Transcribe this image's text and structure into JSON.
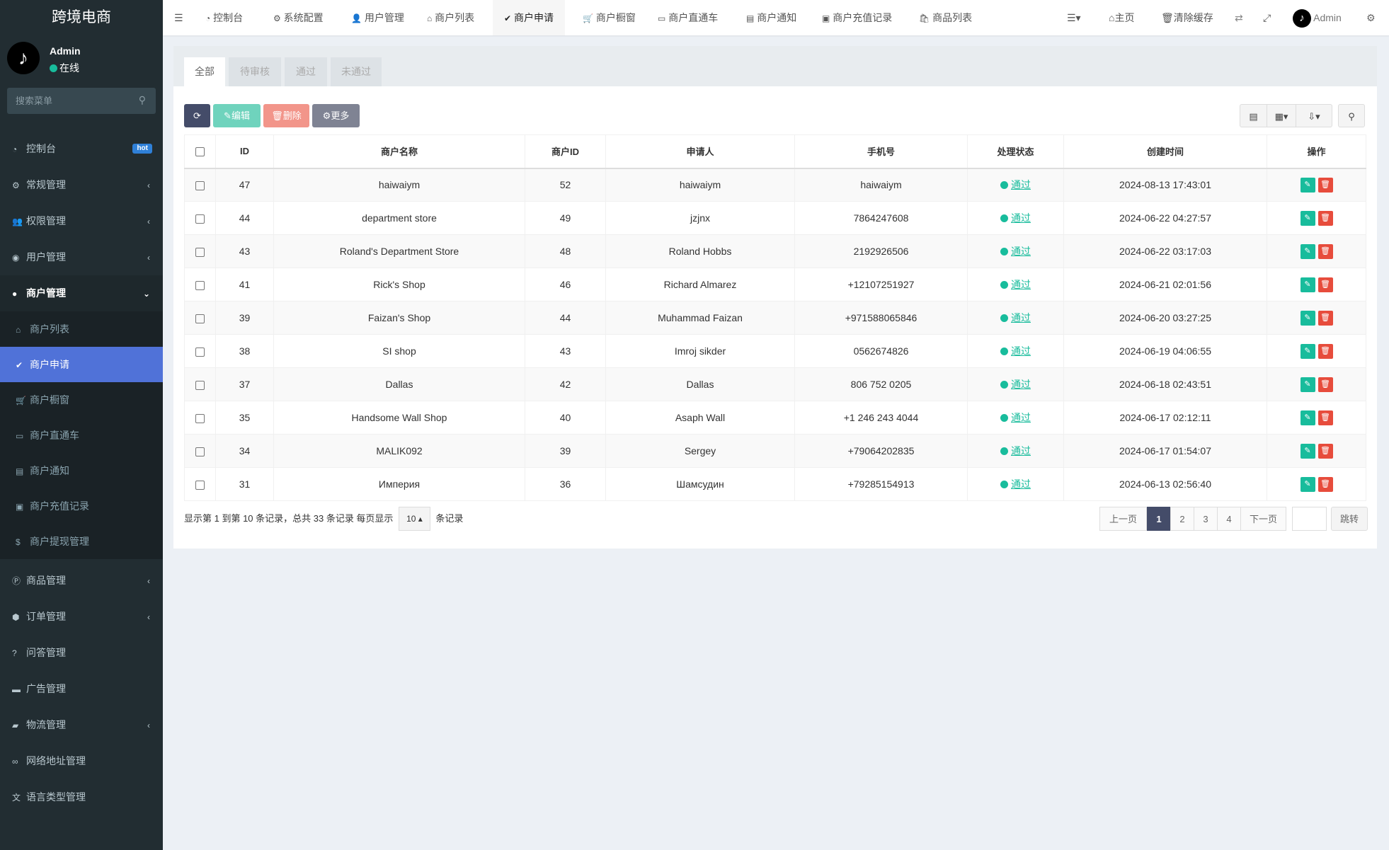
{
  "app": {
    "title": "跨境电商"
  },
  "user": {
    "name": "Admin",
    "status": "在线"
  },
  "search": {
    "placeholder": "搜索菜单"
  },
  "sidebar": {
    "items": [
      {
        "label": "控制台",
        "icon": "dashboard-icon",
        "badge": "hot"
      },
      {
        "label": "常规管理",
        "icon": "cogs-icon"
      },
      {
        "label": "权限管理",
        "icon": "group-icon"
      },
      {
        "label": "用户管理",
        "icon": "user-circle-icon"
      },
      {
        "label": "商户管理",
        "icon": "apple-icon"
      }
    ],
    "sub": [
      {
        "label": "商户列表",
        "icon": "home-icon"
      },
      {
        "label": "商户申请",
        "icon": "check-circle-icon"
      },
      {
        "label": "商户橱窗",
        "icon": "cart-icon"
      },
      {
        "label": "商户直通车",
        "icon": "car-icon"
      },
      {
        "label": "商户通知",
        "icon": "list-alt-icon"
      },
      {
        "label": "商户充值记录",
        "icon": "money-icon"
      },
      {
        "label": "商户提现管理",
        "icon": "dollar-icon"
      }
    ],
    "after": [
      {
        "label": "商品管理",
        "icon": "product-hunt-icon"
      },
      {
        "label": "订单管理",
        "icon": "cube-icon"
      },
      {
        "label": "问答管理",
        "icon": "question-icon"
      },
      {
        "label": "广告管理",
        "icon": "ad-icon"
      },
      {
        "label": "物流管理",
        "icon": "truck-icon"
      },
      {
        "label": "网络地址管理",
        "icon": "link-icon"
      },
      {
        "label": "语言类型管理",
        "icon": "language-icon"
      }
    ]
  },
  "topnav": {
    "tabs": [
      "控制台",
      "系统配置",
      "用户管理",
      "商户列表",
      "商户申请",
      "商户橱窗",
      "商户直通车",
      "商户通知",
      "商户充值记录",
      "商品列表"
    ],
    "home": "主页",
    "clear_cache": "清除缓存",
    "admin": "Admin"
  },
  "page": {
    "tabs": [
      "全部",
      "待审核",
      "通过",
      "未通过"
    ],
    "toolbar": {
      "edit": "编辑",
      "delete": "删除",
      "more": "更多"
    },
    "columns": [
      "ID",
      "商户名称",
      "商户ID",
      "申请人",
      "手机号",
      "处理状态",
      "创建时间",
      "操作"
    ],
    "rows": [
      {
        "id": "47",
        "name": "haiwaiym",
        "mid": "52",
        "applicant": "haiwaiym",
        "phone": "haiwaiym",
        "status": "通过",
        "created": "2024-08-13 17:43:01"
      },
      {
        "id": "44",
        "name": "department store",
        "mid": "49",
        "applicant": "jzjnx",
        "phone": "7864247608",
        "status": "通过",
        "created": "2024-06-22 04:27:57"
      },
      {
        "id": "43",
        "name": "Roland's Department Store",
        "mid": "48",
        "applicant": "Roland Hobbs",
        "phone": "2192926506",
        "status": "通过",
        "created": "2024-06-22 03:17:03"
      },
      {
        "id": "41",
        "name": "Rick's Shop",
        "mid": "46",
        "applicant": "Richard Almarez",
        "phone": "+12107251927",
        "status": "通过",
        "created": "2024-06-21 02:01:56"
      },
      {
        "id": "39",
        "name": "Faizan's Shop",
        "mid": "44",
        "applicant": "Muhammad Faizan",
        "phone": "+971588065846",
        "status": "通过",
        "created": "2024-06-20 03:27:25"
      },
      {
        "id": "38",
        "name": "SI shop",
        "mid": "43",
        "applicant": "Imroj sikder",
        "phone": "0562674826",
        "status": "通过",
        "created": "2024-06-19 04:06:55"
      },
      {
        "id": "37",
        "name": "Dallas",
        "mid": "42",
        "applicant": "Dallas",
        "phone": "806 752 0205",
        "status": "通过",
        "created": "2024-06-18 02:43:51"
      },
      {
        "id": "35",
        "name": "Handsome Wall Shop",
        "mid": "40",
        "applicant": "Asaph Wall",
        "phone": "+1 246 243 4044",
        "status": "通过",
        "created": "2024-06-17 02:12:11"
      },
      {
        "id": "34",
        "name": "MALIK092",
        "mid": "39",
        "applicant": "Sergey",
        "phone": "+79064202835",
        "status": "通过",
        "created": "2024-06-17 01:54:07"
      },
      {
        "id": "31",
        "name": "Империя",
        "mid": "36",
        "applicant": "Шамсудин",
        "phone": "+79285154913",
        "status": "通过",
        "created": "2024-06-13 02:56:40"
      }
    ],
    "footer": {
      "summary": "显示第 1 到第 10 条记录，总共 33 条记录 每页显示",
      "page_size": "10",
      "suffix": "条记录"
    },
    "pagination": {
      "prev": "上一页",
      "pages": [
        "1",
        "2",
        "3",
        "4"
      ],
      "current": "1",
      "next": "下一页",
      "jump": "跳转"
    }
  },
  "colors": {
    "sidebar": "#222d32",
    "active": "#5072d8",
    "success": "#18bc9c",
    "danger": "#e74c3c",
    "primary": "#444c69"
  }
}
